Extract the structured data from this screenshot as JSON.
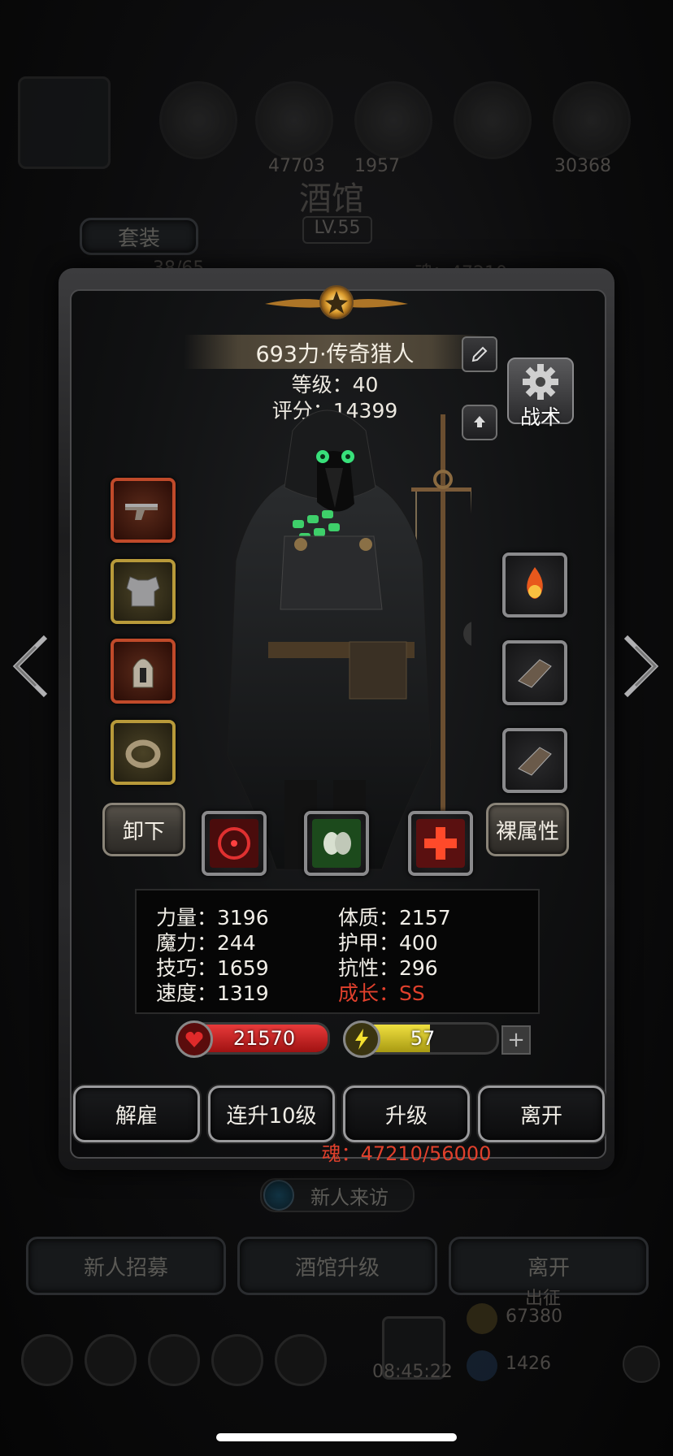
{
  "background": {
    "resources": [
      "47703",
      "1957",
      "30368"
    ],
    "screen_title": "酒馆",
    "level": "LV.55",
    "suit_tab": "套装",
    "heroes_count": "38/65",
    "soul_text": "魂：47210",
    "visitor_label": "新人来访",
    "tabs": [
      "新人招募",
      "酒馆升级",
      "离开"
    ],
    "exit_small": "出征",
    "gold": "67380",
    "gems": "1426",
    "time": "08:45:22"
  },
  "hero": {
    "name": "693力·传奇猎人",
    "level_text": "等级：40",
    "score_text": "评分：14399",
    "tactics_label": "战术"
  },
  "buttons": {
    "unequip": "卸下",
    "bare_attr": "裸属性"
  },
  "stats": {
    "strength": "力量：3196",
    "constitution": "体质：2157",
    "magic": "魔力：244",
    "armor": "护甲：400",
    "skill": "技巧：1659",
    "resistance": "抗性：296",
    "speed": "速度：1319",
    "growth": "成长：SS"
  },
  "bars": {
    "hp": "21570",
    "energy": "57",
    "energy_fraction": 0.55
  },
  "actions": [
    "解雇",
    "连升10级",
    "升级",
    "离开"
  ],
  "soul_cost": "魂：47210/56000",
  "colors": {
    "accent_red": "#e0402c",
    "hp_red": "#c01a1a",
    "energy_yellow": "#d4c22a"
  },
  "icons": {
    "left_slots": [
      "pistol-icon",
      "chest-armor-icon",
      "helmet-icon",
      "ring-icon"
    ],
    "right_slots": [
      "fire-gem-icon",
      "gauntlet-icon",
      "gauntlet-icon"
    ],
    "skills": [
      "target-skill-icon",
      "poison-skull-skill-icon",
      "heal-cross-skill-icon"
    ]
  }
}
